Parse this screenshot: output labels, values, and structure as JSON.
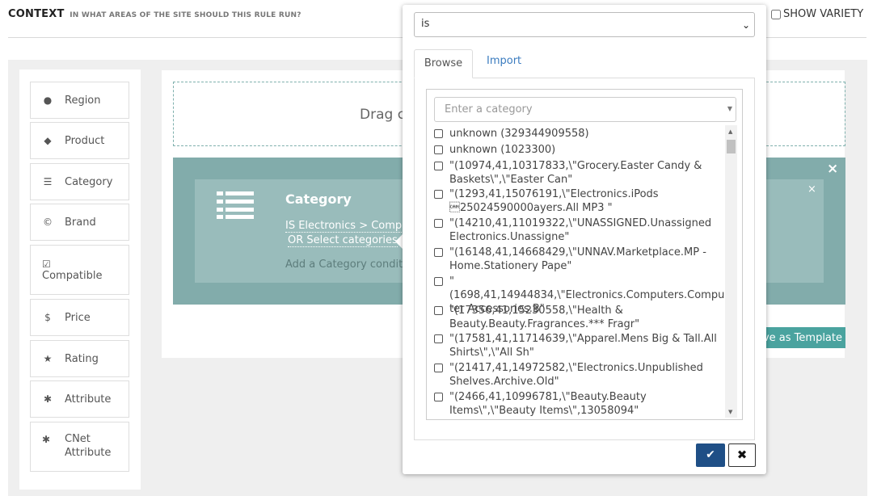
{
  "header": {
    "title": "CONTEXT",
    "subtitle": "IN WHAT AREAS OF THE SITE SHOULD THIS RULE RUN?",
    "show_variety": "SHOW VARIETY"
  },
  "sidebar": {
    "items": [
      {
        "label": "Region",
        "icon": "globe-icon"
      },
      {
        "label": "Product",
        "icon": "tag-icon"
      },
      {
        "label": "Category",
        "icon": "list-icon"
      },
      {
        "label": "Brand",
        "icon": "copyright-icon"
      },
      {
        "label": "Compatible",
        "icon": "check-square-icon"
      },
      {
        "label": "Price",
        "icon": "dollar-icon"
      },
      {
        "label": "Rating",
        "icon": "star-icon"
      },
      {
        "label": "Attribute",
        "icon": "asterisk-icon"
      },
      {
        "label": "CNet Attribute",
        "icon": "asterisk-icon"
      }
    ]
  },
  "main": {
    "dropzone_text": "Drag c",
    "condition": {
      "title": "Category",
      "is_line": "IS Electronics > Comput",
      "or_line": "OR Select categories",
      "add_line": "Add a Category conditi"
    },
    "template_button": "ve as Template",
    "close_glyph": "×"
  },
  "popover": {
    "operator_value": "is",
    "tabs": {
      "browse": "Browse",
      "import": "Import"
    },
    "category_placeholder": "Enter a category",
    "options": [
      "unknown (329344909558)",
      "unknown (1023300)",
      "\"(10974,41,10317833,\\\"Grocery.Easter Candy & Baskets\\\",\\\"Easter Can\"",
      "\"(1293,41,15076191,\\\"Electronics.iPods \u001825024590000ayers.All MP3 \"",
      "\"(14210,41,11019322,\\\"UNASSIGNED.Unassigned Electronics.Unassigne\"",
      "\"(16148,41,14668429,\\\"UNNAV.Marketplace.MP - Home.Stationery Pape\"",
      "\"(1698,41,14944834,\\\"Electronics.Computers.Computer Accessories.B\"",
      "\"(17356,41,15230558,\\\"Health & Beauty.Beauty.Fragrances.*** Fragr\"",
      "\"(17581,41,11714639,\\\"Apparel.Mens Big & Tall.All Shirts\\\",\\\"All Sh\"",
      "\"(21417,41,14972582,\\\"Electronics.Unpublished Shelves.Archive.Old\"",
      "\"(2466,41,10996781,\\\"Beauty.Beauty Items\\\",\\\"Beauty Items\\\",13058094\""
    ],
    "ok_glyph": "✔",
    "cancel_glyph": "✖"
  }
}
